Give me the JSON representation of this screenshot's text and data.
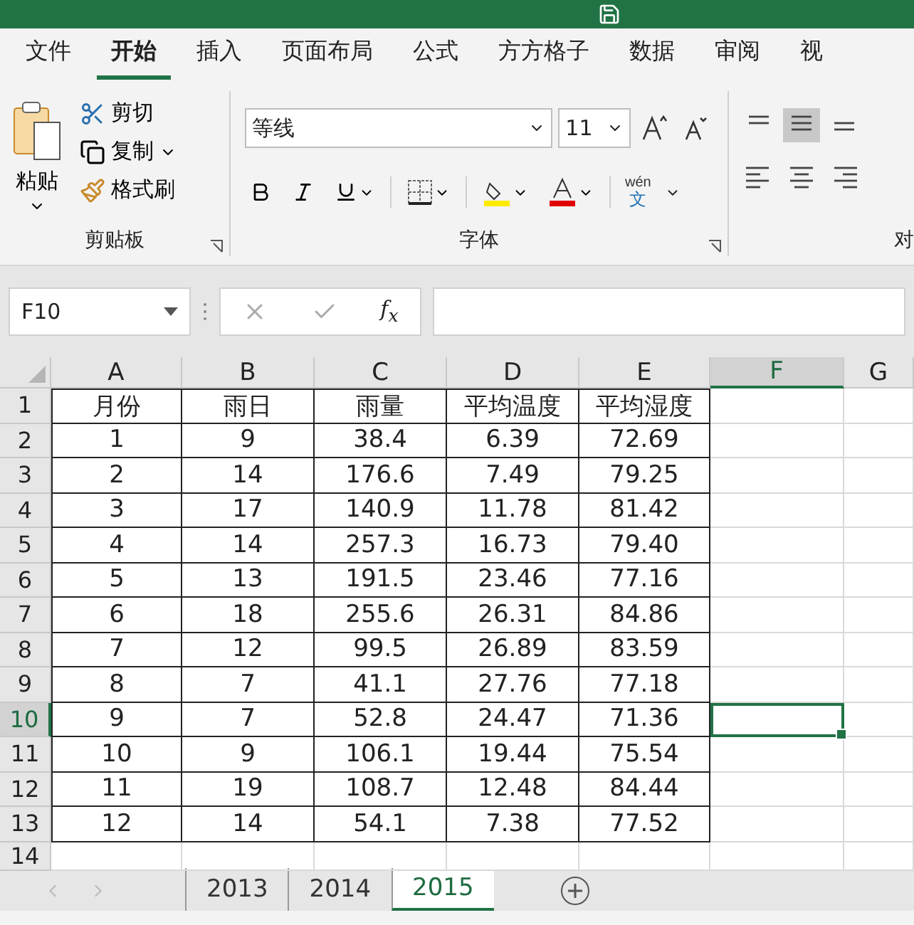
{
  "menu_tabs": [
    {
      "label": "文件",
      "selected": false
    },
    {
      "label": "开始",
      "selected": true
    },
    {
      "label": "插入",
      "selected": false
    },
    {
      "label": "页面布局",
      "selected": false
    },
    {
      "label": "公式",
      "selected": false
    },
    {
      "label": "方方格子",
      "selected": false
    },
    {
      "label": "数据",
      "selected": false
    },
    {
      "label": "审阅",
      "selected": false
    },
    {
      "label": "视",
      "selected": false
    }
  ],
  "ribbon": {
    "clipboard": {
      "paste": "粘贴",
      "cut": "剪切",
      "copy": "复制",
      "format_painter": "格式刷",
      "label": "剪贴板"
    },
    "font": {
      "font_name": "等线",
      "font_size": "11",
      "phonetic_top": "wén",
      "phonetic_bottom": "文",
      "label": "字体"
    },
    "alignment": {
      "label": "对"
    }
  },
  "formula_bar": {
    "name_box": "F10",
    "function_label": "f$_{x}$"
  },
  "grid": {
    "columns": [
      {
        "label": "A",
        "selected": false
      },
      {
        "label": "B",
        "selected": false
      },
      {
        "label": "C",
        "selected": false
      },
      {
        "label": "D",
        "selected": false
      },
      {
        "label": "E",
        "selected": false
      },
      {
        "label": "F",
        "selected": true
      },
      {
        "label": "G",
        "selected": false
      }
    ],
    "rows": [
      {
        "number": "1",
        "selected": false,
        "cells": [
          "月份",
          "雨日",
          "雨量",
          "平均温度",
          "平均湿度"
        ]
      },
      {
        "number": "2",
        "selected": false,
        "cells": [
          "1",
          "9",
          "38.4",
          "6.39",
          "72.69"
        ]
      },
      {
        "number": "3",
        "selected": false,
        "cells": [
          "2",
          "14",
          "176.6",
          "7.49",
          "79.25"
        ]
      },
      {
        "number": "4",
        "selected": false,
        "cells": [
          "3",
          "17",
          "140.9",
          "11.78",
          "81.42"
        ]
      },
      {
        "number": "5",
        "selected": false,
        "cells": [
          "4",
          "14",
          "257.3",
          "16.73",
          "79.40"
        ]
      },
      {
        "number": "6",
        "selected": false,
        "cells": [
          "5",
          "13",
          "191.5",
          "23.46",
          "77.16"
        ]
      },
      {
        "number": "7",
        "selected": false,
        "cells": [
          "6",
          "18",
          "255.6",
          "26.31",
          "84.86"
        ]
      },
      {
        "number": "8",
        "selected": false,
        "cells": [
          "7",
          "12",
          "99.5",
          "26.89",
          "83.59"
        ]
      },
      {
        "number": "9",
        "selected": false,
        "cells": [
          "8",
          "7",
          "41.1",
          "27.76",
          "77.18"
        ]
      },
      {
        "number": "10",
        "selected": true,
        "cells": [
          "9",
          "7",
          "52.8",
          "24.47",
          "71.36"
        ]
      },
      {
        "number": "11",
        "selected": false,
        "cells": [
          "10",
          "9",
          "106.1",
          "19.44",
          "75.54"
        ]
      },
      {
        "number": "12",
        "selected": false,
        "cells": [
          "11",
          "19",
          "108.7",
          "12.48",
          "84.44"
        ]
      },
      {
        "number": "13",
        "selected": false,
        "cells": [
          "12",
          "14",
          "54.1",
          "7.38",
          "77.52"
        ]
      },
      {
        "number": "14",
        "selected": false
      }
    ]
  },
  "sheet_tabs": [
    {
      "label": "2013",
      "selected": false
    },
    {
      "label": "2014",
      "selected": false
    },
    {
      "label": "2015",
      "selected": true
    }
  ]
}
